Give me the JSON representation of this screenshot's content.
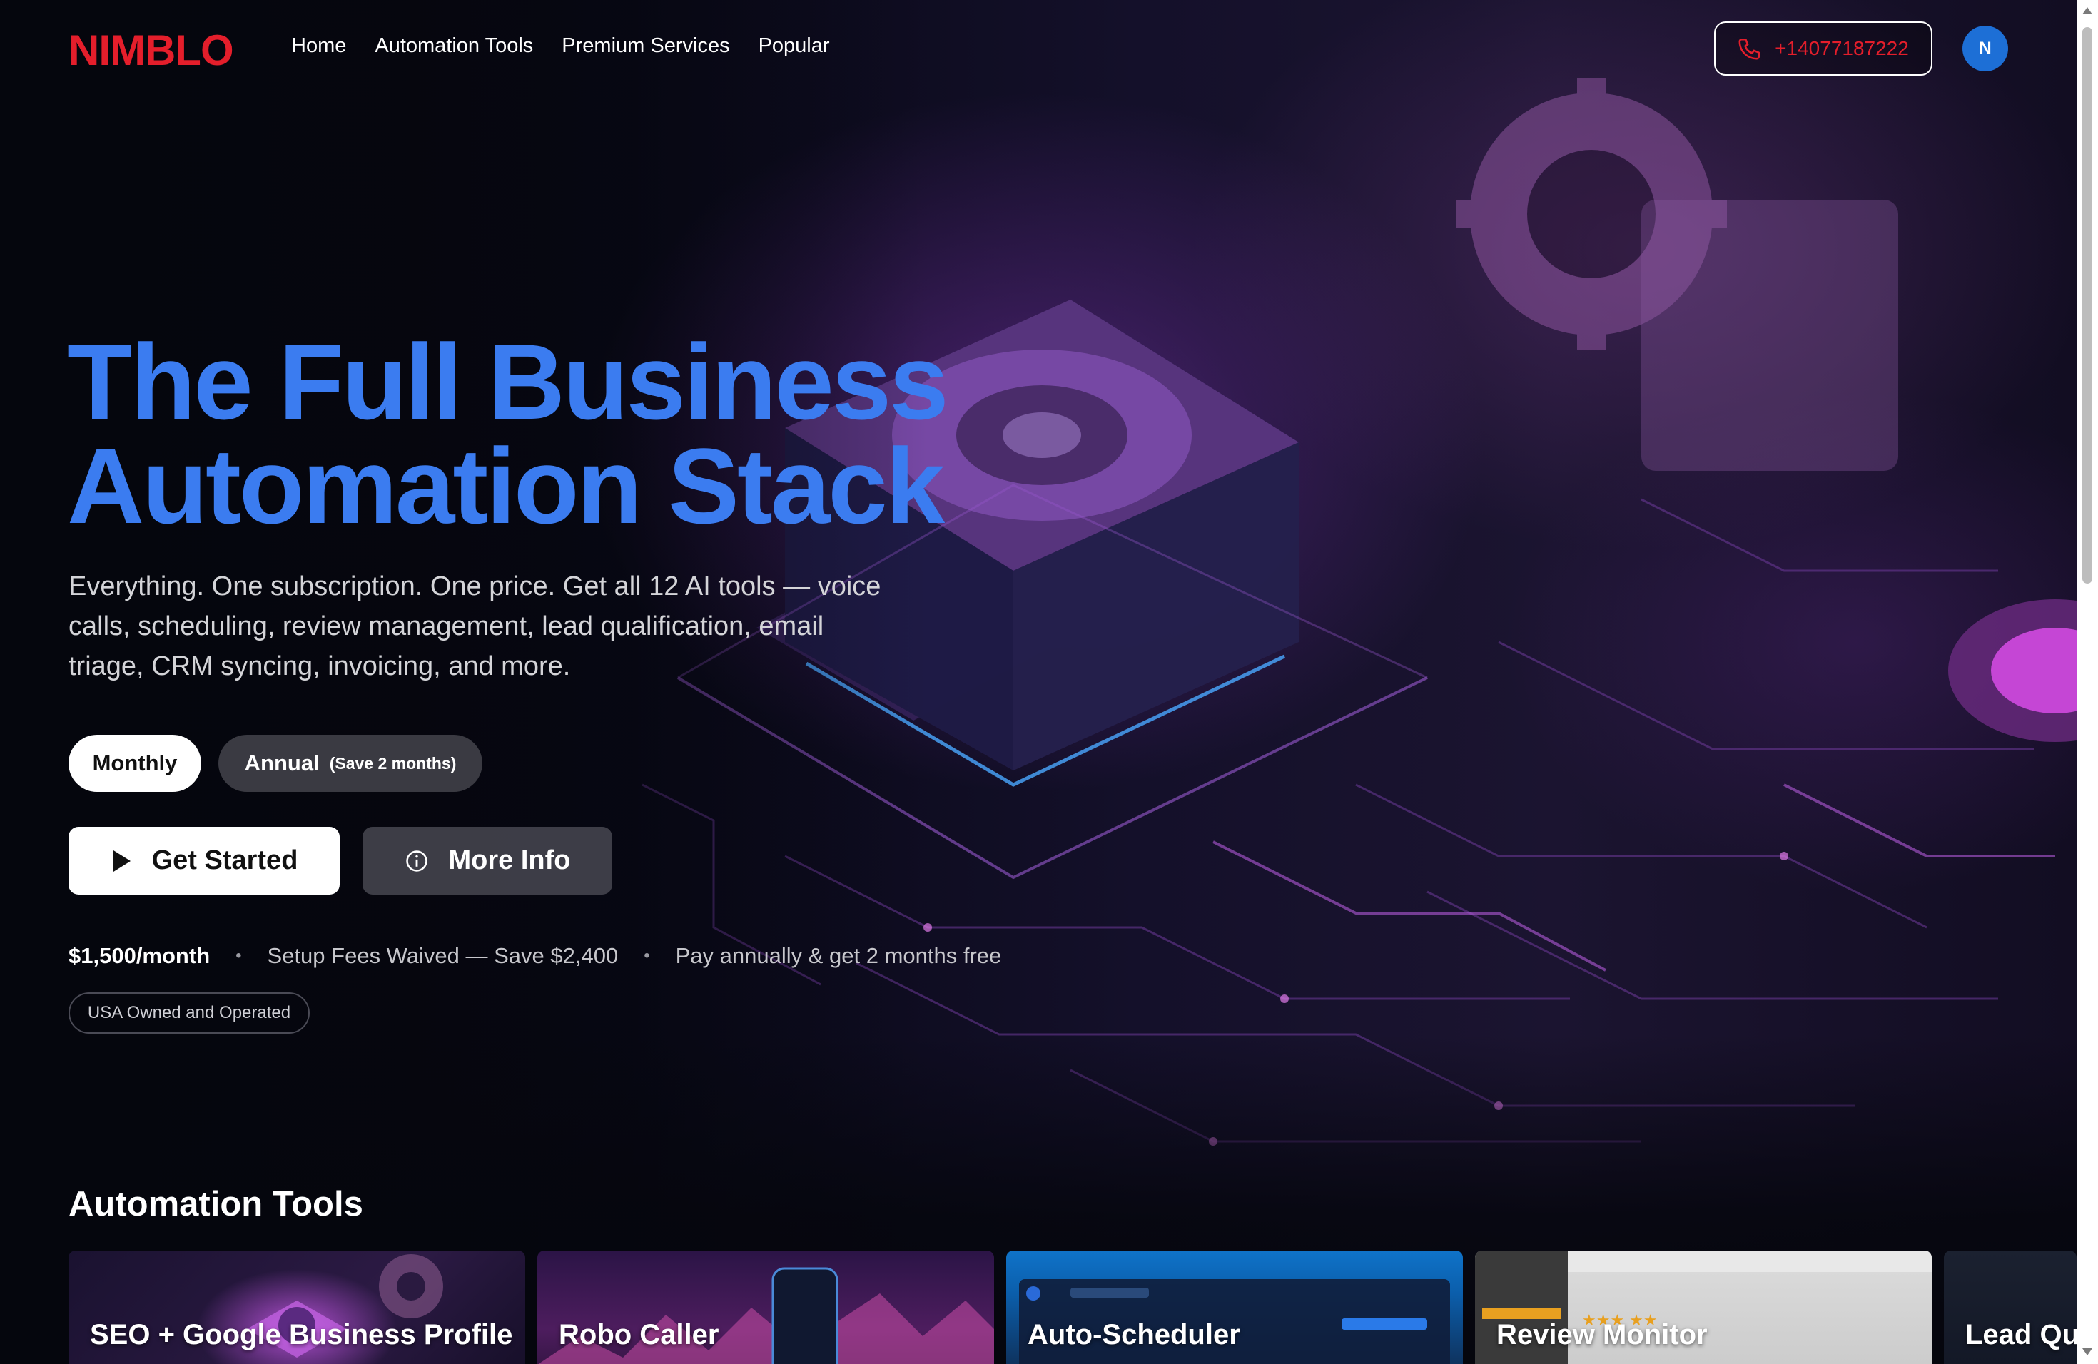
{
  "nav": {
    "logo": "NIMBLO",
    "links": [
      "Home",
      "Automation Tools",
      "Premium Services",
      "Popular"
    ],
    "phone": "+14077187222",
    "avatar_initial": "N"
  },
  "hero": {
    "title_line1": "The Full Business",
    "title_line2": "Automation Stack",
    "subtitle": "Everything. One subscription. One price. Get all 12 AI tools — voice calls, scheduling, review management, lead qualification, email triage, CRM syncing, invoicing, and more.",
    "billing_toggle": {
      "monthly": "Monthly",
      "annual": "Annual",
      "annual_note": "(Save 2 months)",
      "selected": "Monthly"
    },
    "cta_primary": "Get Started",
    "cta_secondary": "More Info",
    "price": "$1,500/month",
    "setup_note": "Setup Fees Waived — Save $2,400",
    "annual_note": "Pay annually & get 2 months free",
    "badge": "USA Owned and Operated"
  },
  "tools": {
    "section_title": "Automation Tools",
    "cards": [
      {
        "label": "SEO + Google Business Profile"
      },
      {
        "label": "Robo Caller"
      },
      {
        "label": "Auto-Scheduler"
      },
      {
        "label": "Review Monitor"
      },
      {
        "label": "Lead Qualifier"
      }
    ]
  },
  "colors": {
    "brand_red": "#e41e2b",
    "title_blue": "#3b7cf0",
    "avatar_blue": "#1d6fd6"
  }
}
